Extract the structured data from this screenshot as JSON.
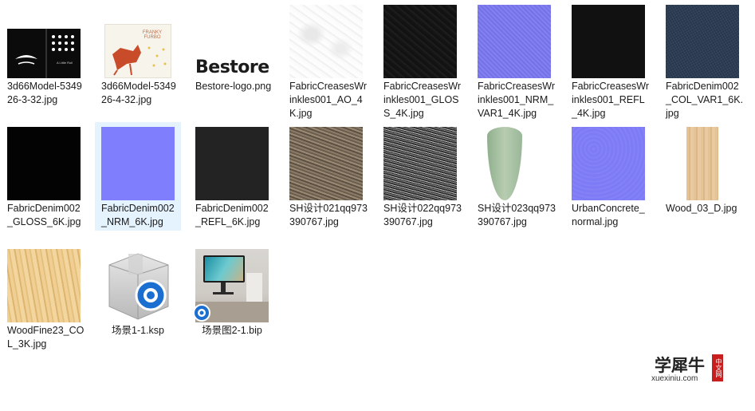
{
  "files": [
    {
      "name": "3d66Model-534926-3-32.jpg",
      "icon": "book-cover-thumbnail"
    },
    {
      "name": "3d66Model-534926-4-32.jpg",
      "icon": "book-cover-thumbnail"
    },
    {
      "name": "Bestore-logo.png",
      "icon": "bestore-logo-thumbnail",
      "logo_text": "Bestore"
    },
    {
      "name": "FabricCreasesWrinkles001_AO_4K.jpg",
      "icon": "texture-thumbnail"
    },
    {
      "name": "FabricCreasesWrinkles001_GLOSS_4K.jpg",
      "icon": "texture-thumbnail"
    },
    {
      "name": "FabricCreasesWrinkles001_NRM_VAR1_4K.jpg",
      "icon": "texture-thumbnail"
    },
    {
      "name": "FabricCreasesWrinkles001_REFL_4K.jpg",
      "icon": "texture-thumbnail"
    },
    {
      "name": "FabricDenim002_COL_VAR1_6K.jpg",
      "icon": "texture-thumbnail"
    },
    {
      "name": "FabricDenim002_GLOSS_6K.jpg",
      "icon": "texture-thumbnail"
    },
    {
      "name": "FabricDenim002_NRM_6K.jpg",
      "icon": "texture-thumbnail"
    },
    {
      "name": "FabricDenim002_REFL_6K.jpg",
      "icon": "texture-thumbnail"
    },
    {
      "name": "SH设计021qq973390767.jpg",
      "icon": "texture-thumbnail"
    },
    {
      "name": "SH设计022qq973390767.jpg",
      "icon": "texture-thumbnail"
    },
    {
      "name": "SH设计023qq973390767.jpg",
      "icon": "leaf-thumbnail"
    },
    {
      "name": "UrbanConcrete_normal.jpg",
      "icon": "texture-thumbnail"
    },
    {
      "name": "Wood_03_D.jpg",
      "icon": "texture-thumbnail"
    },
    {
      "name": "WoodFine23_COL_3K.jpg",
      "icon": "texture-thumbnail"
    },
    {
      "name": "场景1-1.ksp",
      "icon": "keyshot-package-icon"
    },
    {
      "name": "场景图2-1.bip",
      "icon": "keyshot-scene-thumbnail"
    }
  ],
  "book_cover_1": {
    "text": "A Little Roll"
  },
  "book_cover_2": {
    "title": "FRANKY FURBO"
  },
  "watermark": {
    "brand": "学犀牛",
    "side": "中文网",
    "url": "xuexiniu.com"
  },
  "colors": {
    "selection": "#e5f3ff",
    "text": "#1a1a1a"
  }
}
